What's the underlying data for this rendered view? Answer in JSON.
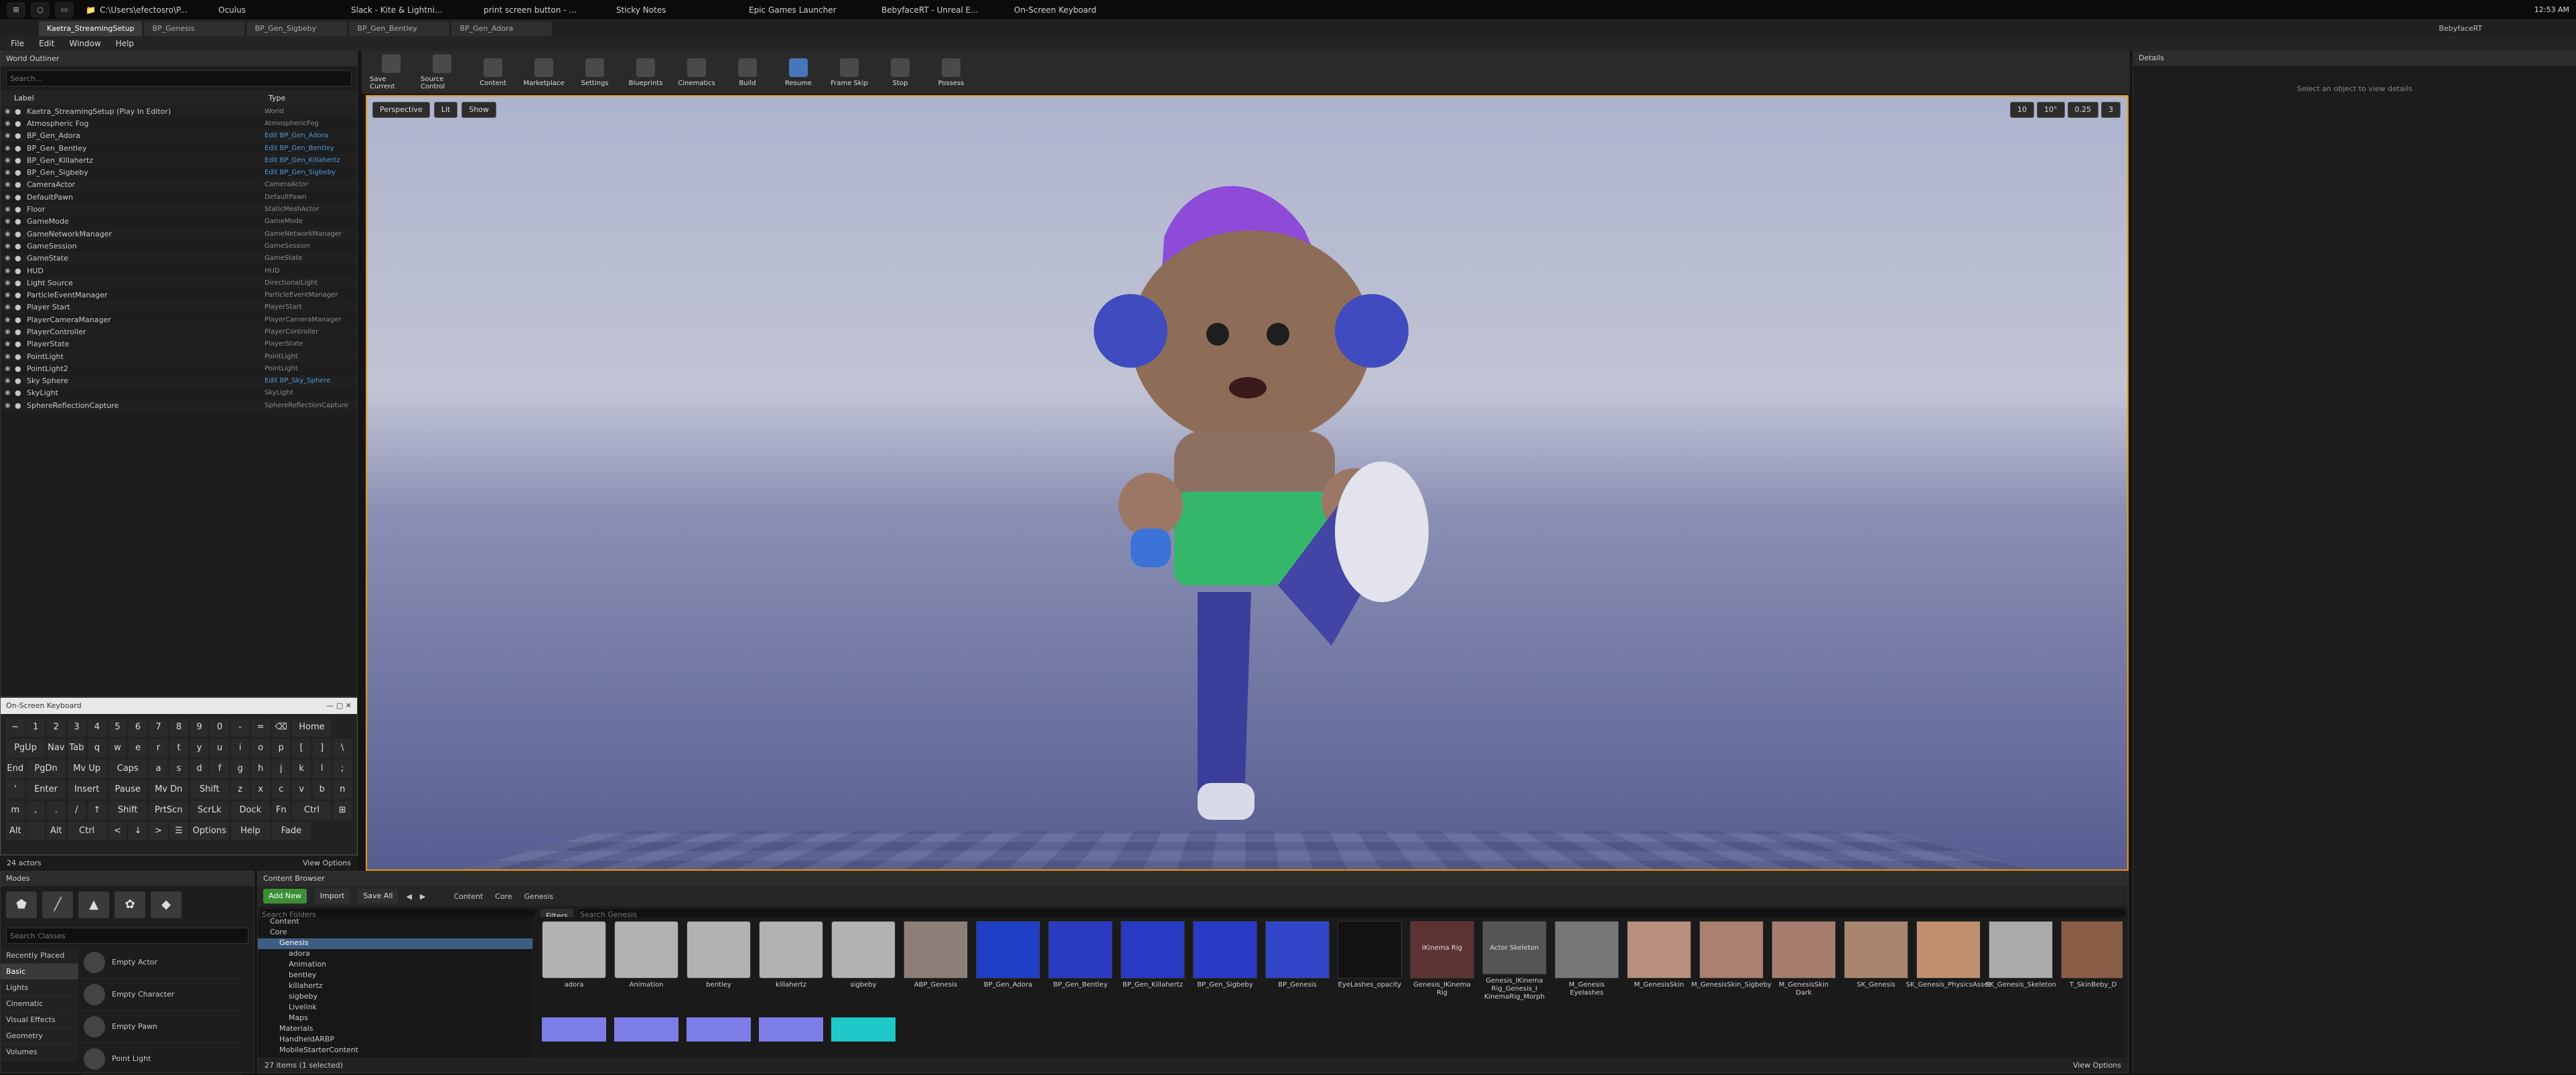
{
  "taskbar": {
    "items": [
      "C:\\Users\\efectosro\\P...",
      "Oculus",
      "Slack - Kite & Lightni...",
      "print screen button - ...",
      "Sticky Notes",
      "Epic Games Launcher",
      "BebyfaceRT - Unreal E...",
      "On-Screen Keyboard"
    ],
    "app_title": "BebyfaceRT",
    "time": "12:53 AM"
  },
  "tabs": [
    "Kaetra_StreamingSetup",
    "BP_Genesis",
    "BP_Gen_Sigbeby",
    "BP_Gen_Bentley",
    "BP_Gen_Adora"
  ],
  "menu": [
    "File",
    "Edit",
    "Window",
    "Help"
  ],
  "outliner": {
    "title": "World Outliner",
    "search": "Search...",
    "label": "Label",
    "type": "Type",
    "rows": [
      [
        "Kaetra_StreamingSetup (Play In Editor)",
        "World",
        false
      ],
      [
        "Atmospheric Fog",
        "AtmosphericFog",
        false
      ],
      [
        "BP_Gen_Adora",
        "Edit BP_Gen_Adora",
        true
      ],
      [
        "BP_Gen_Bentley",
        "Edit BP_Gen_Bentley",
        true
      ],
      [
        "BP_Gen_Killahertz",
        "Edit BP_Gen_Killahertz",
        true
      ],
      [
        "BP_Gen_Sigbeby",
        "Edit BP_Gen_Sigbeby",
        true
      ],
      [
        "CameraActor",
        "CameraActor",
        false
      ],
      [
        "DefaultPawn",
        "DefaultPawn",
        false
      ],
      [
        "Floor",
        "StaticMeshActor",
        false
      ],
      [
        "GameMode",
        "GameMode",
        false
      ],
      [
        "GameNetworkManager",
        "GameNetworkManager",
        false
      ],
      [
        "GameSession",
        "GameSession",
        false
      ],
      [
        "GameState",
        "GameState",
        false
      ],
      [
        "HUD",
        "HUD",
        false
      ],
      [
        "Light Source",
        "DirectionalLight",
        false
      ],
      [
        "ParticleEventManager",
        "ParticleEventManager",
        false
      ],
      [
        "Player Start",
        "PlayerStart",
        false
      ],
      [
        "PlayerCameraManager",
        "PlayerCameraManager",
        false
      ],
      [
        "PlayerController",
        "PlayerController",
        false
      ],
      [
        "PlayerState",
        "PlayerState",
        false
      ],
      [
        "PointLight",
        "PointLight",
        false
      ],
      [
        "PointLight2",
        "PointLight",
        false
      ],
      [
        "Sky Sphere",
        "Edit BP_Sky_Sphere",
        true
      ],
      [
        "SkyLight",
        "SkyLight",
        false
      ],
      [
        "SphereReflectionCapture",
        "SphereReflectionCapture",
        false
      ]
    ],
    "actor_count": "24 actors",
    "view_options": "View Options"
  },
  "keyboard": {
    "title": "On-Screen Keyboard",
    "keys": [
      "~",
      "1",
      "2",
      "3",
      "4",
      "5",
      "6",
      "7",
      "8",
      "9",
      "0",
      "-",
      "=",
      "⌫",
      "Home",
      "PgUp",
      "Nav",
      "Tab",
      "q",
      "w",
      "e",
      "r",
      "t",
      "y",
      "u",
      "i",
      "o",
      "p",
      "[",
      "]",
      "\\",
      "End",
      "PgDn",
      "Mv Up",
      "Caps",
      "a",
      "s",
      "d",
      "f",
      "g",
      "h",
      "j",
      "k",
      "l",
      ";",
      "'",
      "Enter",
      "Insert",
      "Pause",
      "Mv Dn",
      "Shift",
      "z",
      "x",
      "c",
      "v",
      "b",
      "n",
      "m",
      ",",
      ".",
      "/",
      "↑",
      "Shift",
      "PrtScn",
      "ScrLk",
      "Dock",
      "Fn",
      "Ctrl",
      "⊞",
      "Alt",
      "",
      "Alt",
      "Ctrl",
      "<",
      "↓",
      ">",
      "☰",
      "Options",
      "Help",
      "Fade"
    ]
  },
  "toolbar": [
    "Save Current",
    "Source Control",
    "Content",
    "Marketplace",
    "Settings",
    "Blueprints",
    "Cinematics",
    "Build",
    "Resume",
    "Frame Skip",
    "Stop",
    "Possess"
  ],
  "viewport": {
    "perspective": "Perspective",
    "lit": "Lit",
    "show": "Show",
    "speed": "0.25",
    "grid": "10",
    "angle": "10°",
    "camera": "3"
  },
  "details": {
    "title": "Details",
    "empty": "Select an object to view details"
  },
  "modes": {
    "title": "Modes",
    "search": "Search Classes",
    "categories": [
      "Recently Placed",
      "Basic",
      "Lights",
      "Cinematic",
      "Visual Effects",
      "Geometry",
      "Volumes"
    ],
    "items": [
      "Empty Actor",
      "Empty Character",
      "Empty Pawn",
      "Point Light"
    ]
  },
  "content": {
    "title": "Content Browser",
    "add_new": "Add New",
    "import": "Import",
    "save_all": "Save All",
    "path": [
      "Content",
      "Core",
      "Genesis"
    ],
    "filters": "Filters",
    "folder_search": "Search Folders",
    "asset_search": "Search Genesis",
    "tree": [
      "Content",
      "Core",
      "Genesis",
      "adora",
      "Animation",
      "bentley",
      "killahertz",
      "sigbeby",
      "Livelink",
      "Maps",
      "Materials",
      "HandheldARBP",
      "MobileStarterContent"
    ],
    "assets": [
      "adora",
      "Animation",
      "bentley",
      "killahertz",
      "sigbeby",
      "ABP_Genesis",
      "BP_Gen_Adora",
      "BP_Gen_Bentley",
      "BP_Gen_Killahertz",
      "BP_Gen_Sigbeby",
      "BP_Genesis",
      "EyeLashes_opacity",
      "Genesis_IKinema Rig",
      "Genesis_IKinema Rig_Genesis_I KinemaRig_Morph",
      "M_Genesis Eyelashes",
      "M_GenesisSkin",
      "M_GenesisSkin_Sigbeby",
      "M_GenesisSkin Dark",
      "SK_Genesis",
      "SK_Genesis_PhysicsAsset",
      "SK_Genesis_Skeleton",
      "T_SkinBeby_D"
    ],
    "thumb_labels": [
      "IKinema Rig",
      "Actor Skeleton"
    ],
    "status": "27 items (1 selected)",
    "view_options": "View Options"
  }
}
